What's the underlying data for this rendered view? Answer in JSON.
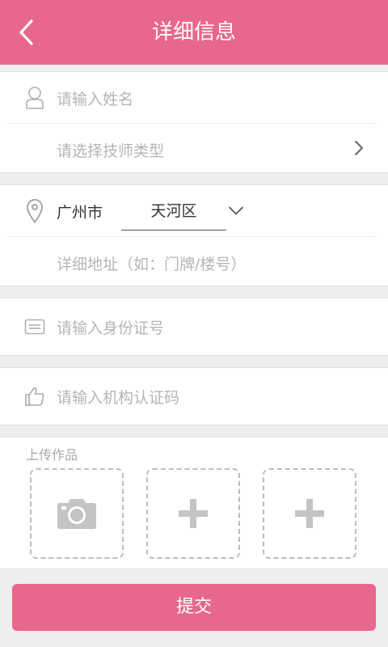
{
  "header": {
    "title": "详细信息",
    "back_icon": "chevron-left-icon"
  },
  "form": {
    "name_placeholder": "请输入姓名",
    "tech_type_placeholder": "请选择技师类型",
    "city": "广州市",
    "district": "天河区",
    "address_placeholder": "详细地址（如：门牌/楼号）",
    "id_placeholder": "请输入身份证号",
    "org_code_placeholder": "请输入机构认证码"
  },
  "upload": {
    "title": "上传作品",
    "slots": [
      "camera-icon",
      "plus-icon",
      "plus-icon"
    ]
  },
  "submit_label": "提交",
  "colors": {
    "accent": "#e8678c",
    "background": "#eeeeee",
    "placeholder": "#b5b5b5",
    "icon_gray": "#bdbdbd"
  }
}
